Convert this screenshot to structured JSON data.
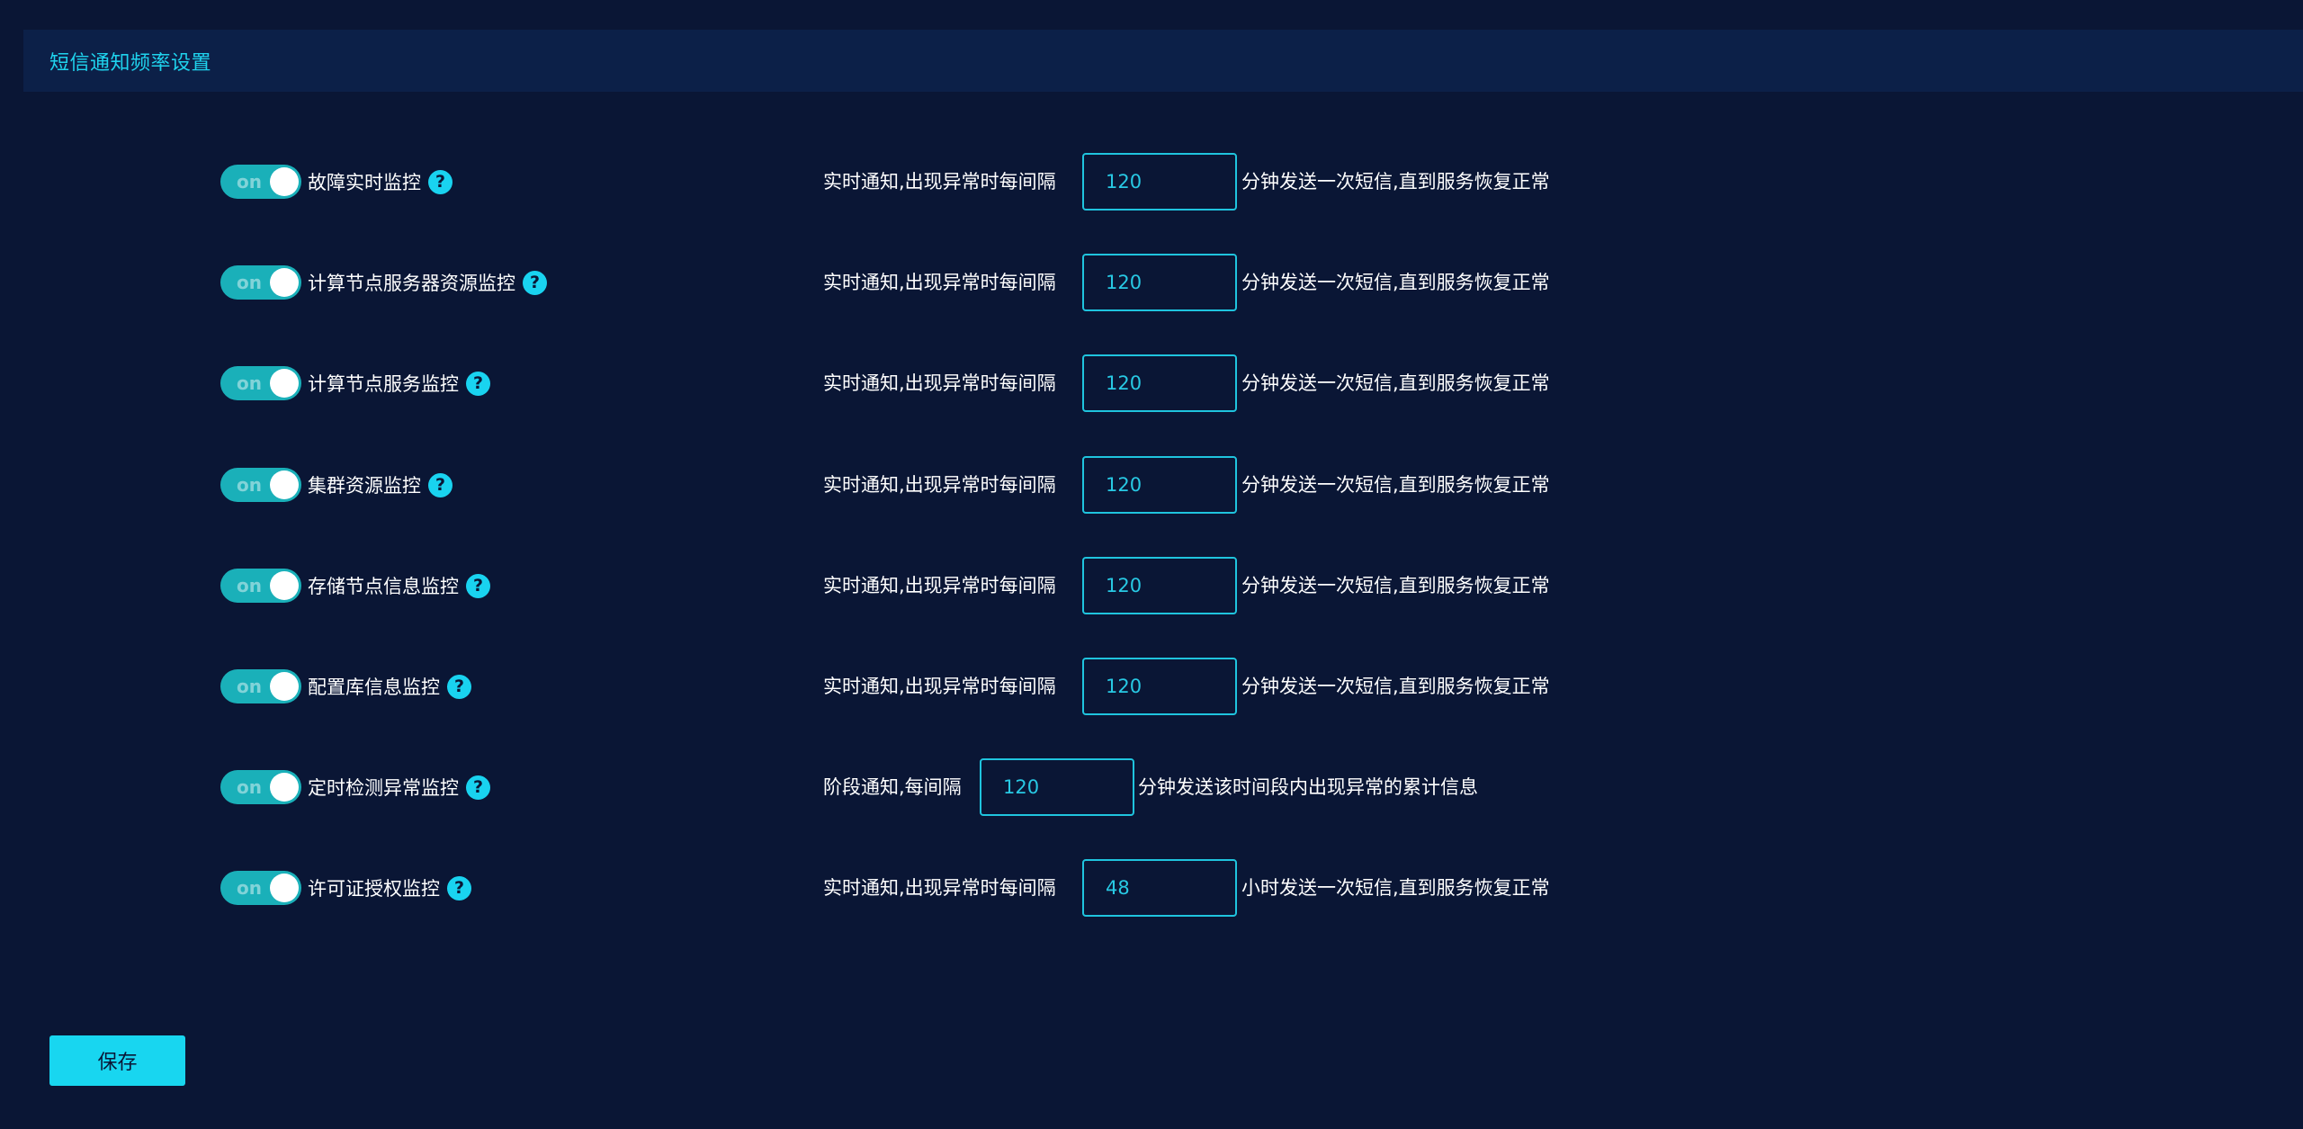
{
  "panel": {
    "title": "短信通知频率设置"
  },
  "rows": [
    {
      "toggle_text": "on",
      "label": "故障实时监控",
      "prefix": "实时通知,出现异常时每间隔",
      "value": "120",
      "suffix": "分钟发送一次短信,直到服务恢复正常"
    },
    {
      "toggle_text": "on",
      "label": "计算节点服务器资源监控",
      "prefix": "实时通知,出现异常时每间隔",
      "value": "120",
      "suffix": "分钟发送一次短信,直到服务恢复正常"
    },
    {
      "toggle_text": "on",
      "label": "计算节点服务监控",
      "prefix": "实时通知,出现异常时每间隔",
      "value": "120",
      "suffix": "分钟发送一次短信,直到服务恢复正常"
    },
    {
      "toggle_text": "on",
      "label": "集群资源监控",
      "prefix": "实时通知,出现异常时每间隔",
      "value": "120",
      "suffix": "分钟发送一次短信,直到服务恢复正常"
    },
    {
      "toggle_text": "on",
      "label": "存储节点信息监控",
      "prefix": "实时通知,出现异常时每间隔",
      "value": "120",
      "suffix": "分钟发送一次短信,直到服务恢复正常"
    },
    {
      "toggle_text": "on",
      "label": "配置库信息监控",
      "prefix": "实时通知,出现异常时每间隔",
      "value": "120",
      "suffix": "分钟发送一次短信,直到服务恢复正常"
    },
    {
      "toggle_text": "on",
      "label": "定时检测异常监控",
      "prefix": "阶段通知,每间隔",
      "value": "120",
      "suffix": "分钟发送该时间段内出现异常的累计信息"
    },
    {
      "toggle_text": "on",
      "label": "许可证授权监控",
      "prefix": "实时通知,出现异常时每间隔",
      "value": "48",
      "suffix": "小时发送一次短信,直到服务恢复正常"
    }
  ],
  "help_icon_glyph": "?",
  "save_label": "保存",
  "colors": {
    "background": "#0a1635",
    "header_background": "#0c2048",
    "accent": "#19d3f0",
    "toggle_on": "#1ab0b9"
  }
}
